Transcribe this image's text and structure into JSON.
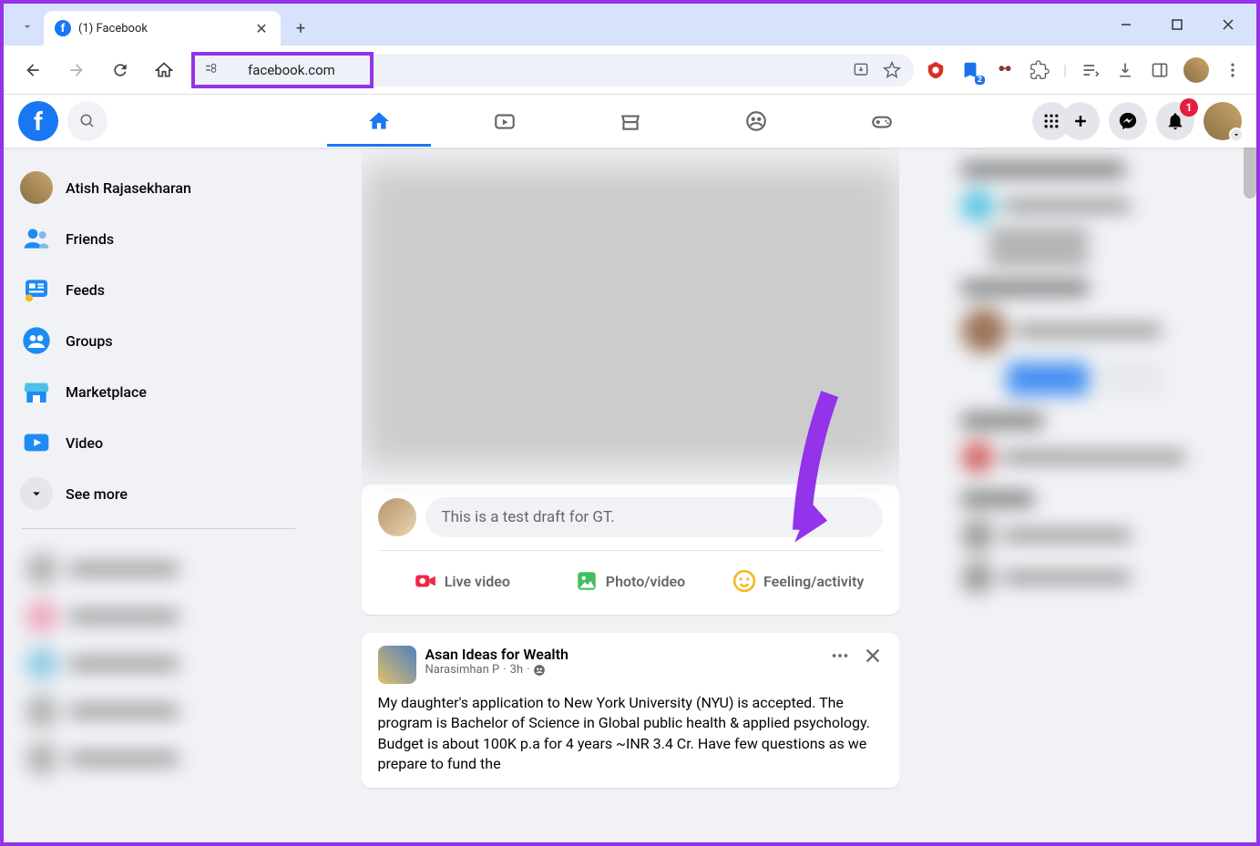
{
  "browser": {
    "tab_title": "(1) Facebook",
    "url": "facebook.com"
  },
  "header": {
    "notifications_count": "1"
  },
  "sidebar": {
    "items": [
      {
        "label": "Atish Rajasekharan"
      },
      {
        "label": "Friends"
      },
      {
        "label": "Feeds"
      },
      {
        "label": "Groups"
      },
      {
        "label": "Marketplace"
      },
      {
        "label": "Video"
      }
    ],
    "see_more": "See more"
  },
  "composer": {
    "placeholder": "This is a test draft for GT.",
    "actions": {
      "live": "Live video",
      "photo": "Photo/video",
      "feeling": "Feeling/activity"
    }
  },
  "post": {
    "group": "Asan Ideas for Wealth",
    "author": "Narasimhan P",
    "time": "3h",
    "body": "My daughter's application to New York University (NYU)  is accepted. The program is Bachelor of Science in Global public health & applied psychology. Budget is about 100K p.a for 4 years ~INR 3.4 Cr. Have few questions as we prepare to fund the"
  }
}
